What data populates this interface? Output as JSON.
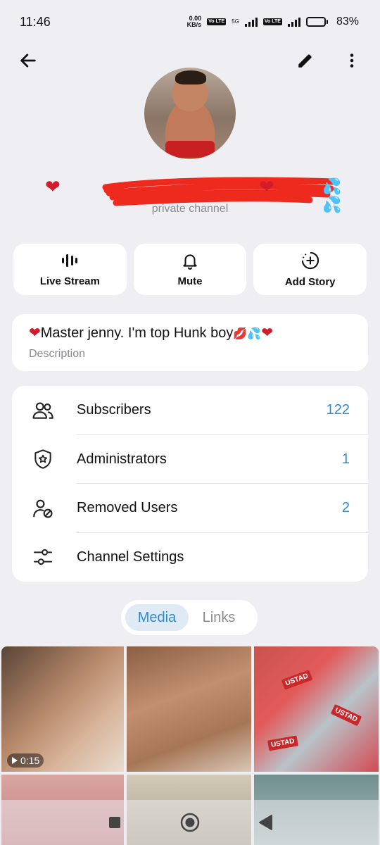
{
  "status_bar": {
    "time": "11:46",
    "net_speed_value": "0.00",
    "net_speed_unit": "KB/s",
    "volte1": "Vo LTE",
    "network_5g": "5G",
    "volte2": "Vo LTE",
    "battery_percent": "83%",
    "battery_level": 0.83
  },
  "header": {
    "back_icon": "arrow-left-icon",
    "edit_icon": "pencil-icon",
    "more_icon": "more-vertical-icon"
  },
  "channel": {
    "subtitle": "private channel"
  },
  "actions": [
    {
      "label": "Live Stream",
      "icon": "live-stream-icon"
    },
    {
      "label": "Mute",
      "icon": "bell-icon"
    },
    {
      "label": "Add Story",
      "icon": "add-story-icon"
    }
  ],
  "description": {
    "text": "Master jenny. I'm top Hunk boy",
    "label": "Description"
  },
  "info_list": [
    {
      "label": "Subscribers",
      "value": "122",
      "icon": "users-icon"
    },
    {
      "label": "Administrators",
      "value": "1",
      "icon": "shield-star-icon"
    },
    {
      "label": "Removed Users",
      "value": "2",
      "icon": "user-blocked-icon"
    },
    {
      "label": "Channel Settings",
      "value": "",
      "icon": "settings-sliders-icon"
    }
  ],
  "tabs": [
    {
      "label": "Media",
      "active": true
    },
    {
      "label": "Links",
      "active": false
    }
  ],
  "media": {
    "first_video_duration": "0:15",
    "pack_text": "USTAD"
  },
  "colors": {
    "accent": "#2f8bcb",
    "background": "#efeff3",
    "heart": "#d21c2b"
  }
}
